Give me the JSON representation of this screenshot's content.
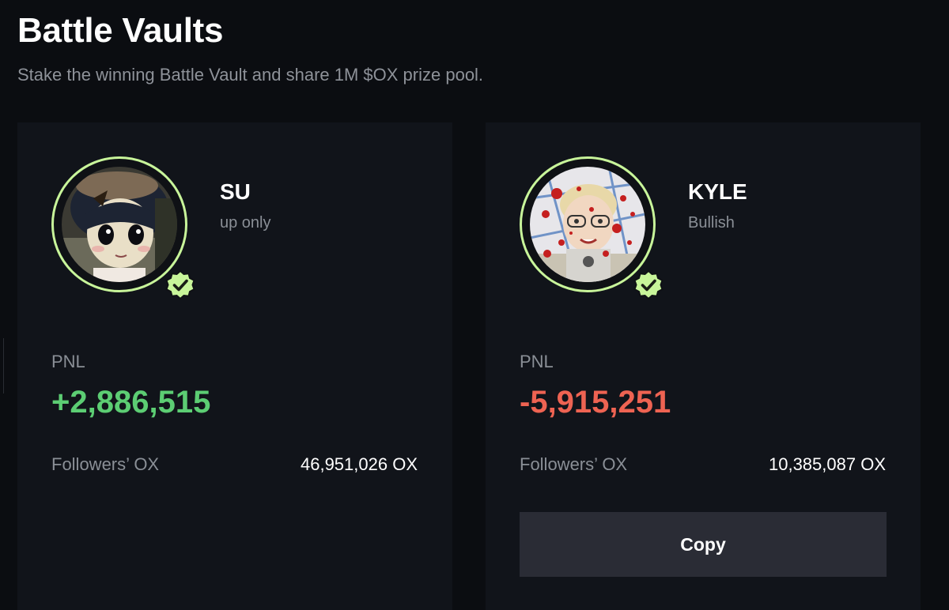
{
  "header": {
    "title": "Battle Vaults",
    "subtitle": "Stake the winning Battle Vault and share 1M $OX prize pool."
  },
  "theme": {
    "background": "#0b0d11",
    "card": "#11141a",
    "ring": "#c8f59a",
    "positive": "#5ccd73",
    "negative": "#ee6352",
    "button": "#2a2c35"
  },
  "vaults": [
    {
      "name": "SU",
      "tagline": "up only",
      "verified_icon": "verified-check-icon",
      "pnl_label": "PNL",
      "pnl": "+2,886,515",
      "followers_label": "Followers’ OX",
      "followers_value": "46,951,026 OX"
    },
    {
      "name": "KYLE",
      "tagline": "Bullish",
      "verified_icon": "verified-check-icon",
      "pnl_label": "PNL",
      "pnl": "-5,915,251",
      "followers_label": "Followers’ OX",
      "followers_value": "10,385,087 OX",
      "button_label": "Copy"
    }
  ]
}
